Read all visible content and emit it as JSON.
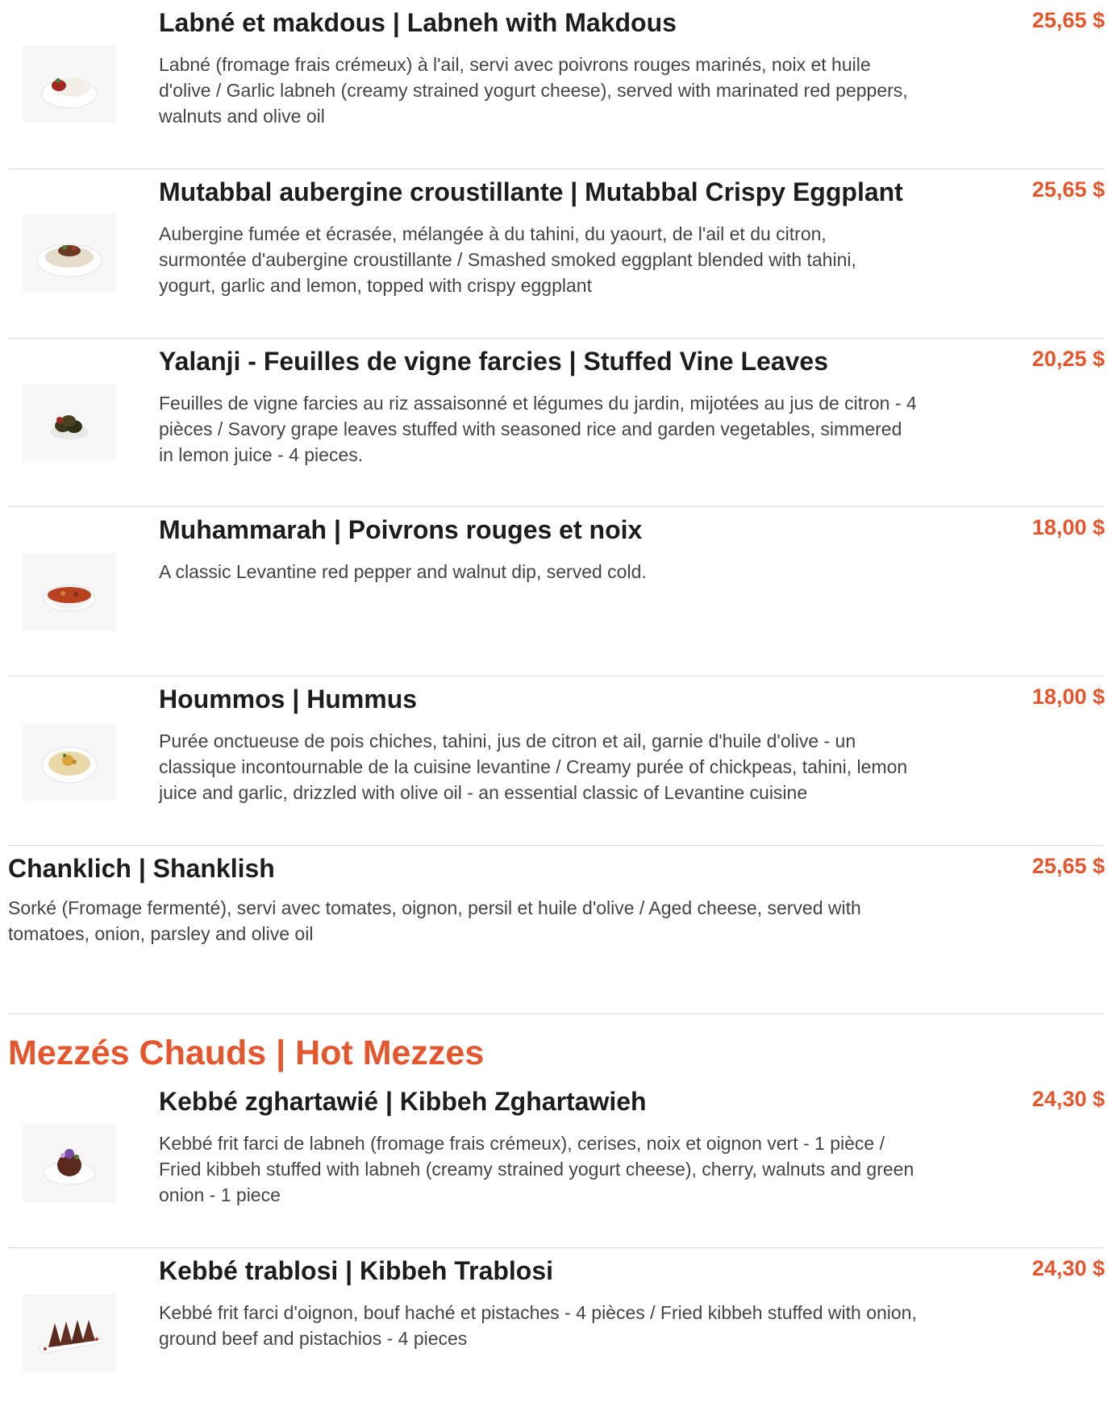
{
  "cold_items": [
    {
      "name": "Labné et makdous | Labneh with Makdous",
      "price": "25,65 $",
      "description": "Labné (fromage frais crémeux) à l'ail, servi avec poivrons rouges marinés, noix et huile d'olive / Garlic labneh (creamy strained yogurt cheese), served with marinated red peppers, walnuts and olive oil"
    },
    {
      "name": "Mutabbal aubergine croustillante | Mutabbal Crispy Eggplant",
      "price": "25,65 $",
      "description": "Aubergine fumée et écrasée, mélangée à du tahini, du yaourt, de l'ail et du citron, surmontée d'aubergine croustillante / Smashed smoked eggplant blended with tahini, yogurt, garlic and lemon, topped with crispy eggplant"
    },
    {
      "name": "Yalanji - Feuilles de vigne farcies | Stuffed Vine Leaves",
      "price": "20,25 $",
      "description": "Feuilles de vigne farcies au riz assaisonné et légumes du jardin, mijotées au jus de citron - 4 pièces / Savory grape leaves stuffed with seasoned rice and garden vegetables, simmered in lemon juice - 4 pieces."
    },
    {
      "name": "Muhammarah | Poivrons rouges et noix",
      "price": "18,00 $",
      "description": "A classic Levantine red pepper and walnut dip, served cold."
    },
    {
      "name": "Hoummos | Hummus",
      "price": "18,00 $",
      "description": "Purée onctueuse de pois chiches, tahini, jus de citron et ail, garnie d'huile d'olive - un classique incontournable de la cuisine levantine / Creamy purée of chickpeas, tahini, lemon juice and garlic, drizzled with olive oil - an essential classic of Levantine cuisine"
    },
    {
      "name": "Chanklich | Shanklish",
      "price": "25,65 $",
      "description": "Sorké (Fromage fermenté), servi avec tomates, oignon, persil et huile d'olive / Aged cheese, served with tomatoes, onion, parsley and olive oil"
    }
  ],
  "hot_section": {
    "title": "Mezzés Chauds | Hot Mezzes",
    "items": [
      {
        "name": "Kebbé zghartawié | Kibbeh Zghartawieh",
        "price": "24,30 $",
        "description": "Kebbé frit farci de labneh (fromage frais crémeux), cerises, noix et oignon vert - 1 pièce / Fried kibbeh stuffed with labneh (creamy strained yogurt cheese), cherry, walnuts and green onion - 1 piece"
      },
      {
        "name": "Kebbé trablosi | Kibbeh Trablosi",
        "price": "24,30 $",
        "description": "Kebbé frit farci d'oignon, bouf haché et pistaches - 4 pièces / Fried kibbeh stuffed with onion, ground beef and pistachios - 4 pieces"
      }
    ]
  },
  "colors": {
    "accent": "#e4572e",
    "title_text": "#1d1d1d",
    "body_text": "#444444",
    "divider": "#d9d9d9"
  },
  "icons": [
    "dish-photo-icon"
  ]
}
